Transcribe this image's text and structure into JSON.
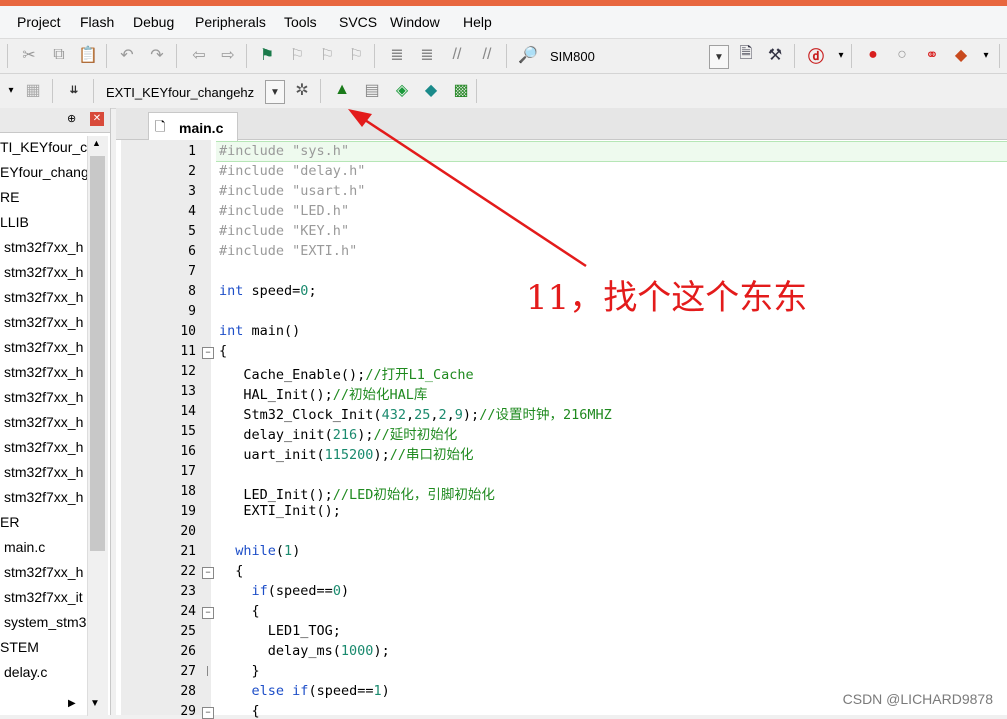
{
  "menu": [
    "Project",
    "Flash",
    "Debug",
    "Peripherals",
    "Tools",
    "SVCS",
    "Window",
    "Help"
  ],
  "toolbar": {
    "target_combo": "SIM800"
  },
  "build_toolbar": {
    "target_select": "EXTI_KEYfour_changehz"
  },
  "project_tree": {
    "items": [
      "TI_KEYfour_ch",
      "EYfour_chang",
      "RE",
      "LLIB",
      "stm32f7xx_h",
      "stm32f7xx_h",
      "stm32f7xx_h",
      "stm32f7xx_h",
      "stm32f7xx_h",
      "stm32f7xx_h",
      "stm32f7xx_h",
      "stm32f7xx_h",
      "stm32f7xx_h",
      "stm32f7xx_h",
      "stm32f7xx_h",
      "ER",
      "main.c",
      "stm32f7xx_h",
      "stm32f7xx_it",
      "system_stm3",
      "STEM",
      "delay.c"
    ]
  },
  "editor": {
    "tab": "main.c",
    "lines": [
      {
        "n": "1",
        "t": "#include \"sys.h\""
      },
      {
        "n": "2",
        "t": "#include \"delay.h\""
      },
      {
        "n": "3",
        "t": "#include \"usart.h\""
      },
      {
        "n": "4",
        "t": "#include \"LED.h\""
      },
      {
        "n": "5",
        "t": "#include \"KEY.h\""
      },
      {
        "n": "6",
        "t": "#include \"EXTI.h\""
      },
      {
        "n": "7",
        "t": ""
      },
      {
        "n": "8",
        "t": "int speed=0;"
      },
      {
        "n": "9",
        "t": ""
      },
      {
        "n": "10",
        "t": "int main()"
      },
      {
        "n": "11",
        "t": "{"
      },
      {
        "n": "12",
        "t": "   Cache_Enable();//打开L1_Cache"
      },
      {
        "n": "13",
        "t": "   HAL_Init();//初始化HAL库"
      },
      {
        "n": "14",
        "t": "   Stm32_Clock_Init(432,25,2,9);//设置时钟，216MHZ"
      },
      {
        "n": "15",
        "t": "   delay_init(216);//延时初始化"
      },
      {
        "n": "16",
        "t": "   uart_init(115200);//串口初始化"
      },
      {
        "n": "17",
        "t": ""
      },
      {
        "n": "18",
        "t": "   LED_Init();//LED初始化，引脚初始化"
      },
      {
        "n": "19",
        "t": "   EXTI_Init();"
      },
      {
        "n": "20",
        "t": ""
      },
      {
        "n": "21",
        "t": "  while(1)"
      },
      {
        "n": "22",
        "t": "  {"
      },
      {
        "n": "23",
        "t": "    if(speed==0)"
      },
      {
        "n": "24",
        "t": "    {"
      },
      {
        "n": "25",
        "t": "      LED1_TOG;"
      },
      {
        "n": "26",
        "t": "      delay_ms(1000);"
      },
      {
        "n": "27",
        "t": "    }"
      },
      {
        "n": "28",
        "t": "    else if(speed==1)"
      },
      {
        "n": "29",
        "t": "    {"
      }
    ]
  },
  "annotation": "11，找个这个东东",
  "watermark": "CSDN @LICHARD9878",
  "colors": {
    "annotation": "#e31b1b",
    "keyword": "#1d4ec8",
    "comment": "#1f8a1f",
    "number": "#1a8a6e",
    "string": "#8b1a1a",
    "preprocessor": "#9a9a9a"
  }
}
